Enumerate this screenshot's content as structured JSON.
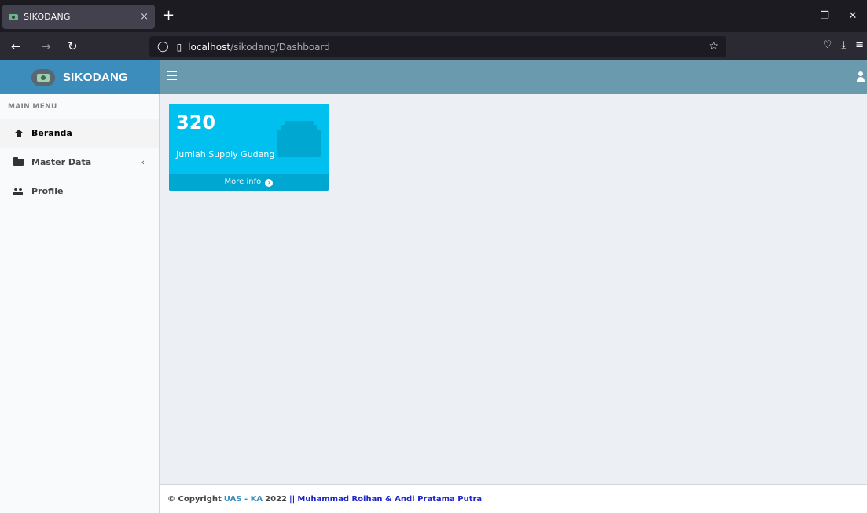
{
  "browser": {
    "tab_title": "SIKODANG",
    "tab_close": "×",
    "new_tab": "+",
    "url_host": "localhost",
    "url_path": "/sikodang/Dashboard",
    "win_minimize": "—",
    "win_restore": "❐",
    "win_close": "✕"
  },
  "app": {
    "logo_text": "SIKODANG"
  },
  "sidebar": {
    "header": "MAIN MENU",
    "items": [
      {
        "label": "Beranda",
        "icon": "home-icon"
      },
      {
        "label": "Master Data",
        "icon": "folder-icon",
        "chevron": "‹"
      },
      {
        "label": "Profile",
        "icon": "users-icon"
      }
    ]
  },
  "dashboard": {
    "info_box": {
      "number": "320",
      "label": "Jumlah Supply Gudang",
      "more_info": "More info",
      "color": "#00c0ef"
    }
  },
  "footer": {
    "copyright": "© Copyright",
    "link": "UAS - KA",
    "year": "2022",
    "separator": "||",
    "authors": "Muhammad Roihan & Andi Pratama Putra"
  },
  "colors": {
    "logo_bg": "#3c8dbc",
    "header_bg": "#6a9aad",
    "content_bg": "#ecf0f5"
  }
}
